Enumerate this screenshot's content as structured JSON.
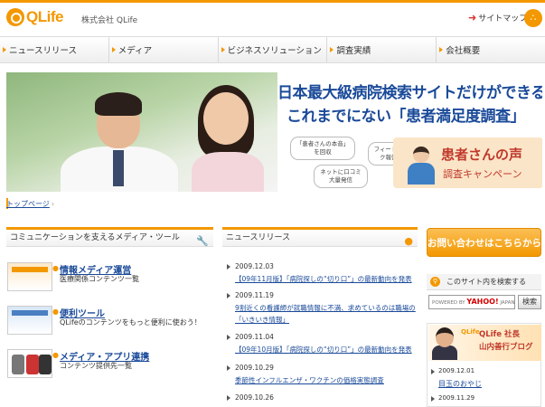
{
  "header": {
    "logo_text": "QLife",
    "company": "株式会社 QLife",
    "sitemap": "サイトマップ"
  },
  "nav": {
    "items": [
      "ニュースリリース",
      "メディア",
      "ビジネスソリューション",
      "調査実績",
      "会社概要"
    ]
  },
  "hero": {
    "title1": "日本最大級病院検索サイトだけができる",
    "title2": "これまでにない「患者満足度調査」",
    "bubble1": "「患者さんの本音」を回収",
    "bubble2": "フィードバック報告書",
    "bubble3": "ネットに口コミ大量発信",
    "voice_title": "患者さんの声",
    "voice_sub": "調査キャンペーン"
  },
  "breadcrumb": "トップページ",
  "media": {
    "heading": "コミュニケーションを支えるメディア・ツール",
    "items": [
      {
        "title": "情報メディア運営",
        "desc": "医療関係コンテンツ一覧"
      },
      {
        "title": "便利ツール",
        "desc": "QLifeのコンテンツをもっと便利に使おう！"
      },
      {
        "title": "メディア・アプリ連携",
        "desc": "コンテンツ提供先一覧"
      }
    ]
  },
  "news": {
    "heading": "ニュースリリース",
    "items": [
      {
        "date": "2009.12.03",
        "title": "【09年11月版】「病院探しの“切り口”」の最新動向を発表",
        "title2": ""
      },
      {
        "date": "2009.11.19",
        "title": "9割近くの看護師が就職情報に不満、求めているのは職場の",
        "title2": "「いきいき情報」"
      },
      {
        "date": "2009.11.04",
        "title": "【09年10月版】「病院探しの“切り口”」の最新動向を発表",
        "title2": ""
      },
      {
        "date": "2009.10.29",
        "title": "季節性インフルエンザ・ワクチンの価格実態調査",
        "title2": ""
      },
      {
        "date": "2009.10.26",
        "title": "",
        "title2": ""
      }
    ]
  },
  "sidebar": {
    "contact": "お問い合わせはこちらから",
    "search_heading": "このサイト内を検索する",
    "search_powered": "POWERED BY",
    "search_brand": "YAHOO!",
    "search_brand_sub": "JAPAN",
    "search_button": "検索",
    "blog_logo": "QLife",
    "blog_title1": "QLife 社長",
    "blog_title2": "山内善行ブログ",
    "blog_entries": [
      {
        "date": "2009.12.01",
        "title": "目玉のおやじ"
      },
      {
        "date": "2009.11.29",
        "title": ""
      }
    ]
  },
  "colors": {
    "accent": "#f39800",
    "link": "#1a4a99",
    "headline": "#1a4a99",
    "voice": "#c0392b"
  }
}
